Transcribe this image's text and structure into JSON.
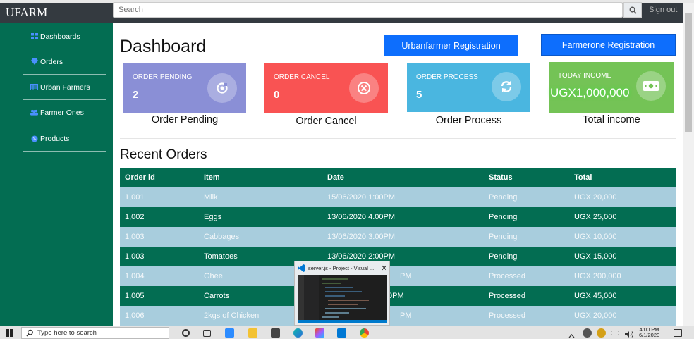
{
  "app": {
    "brand": "UFARM"
  },
  "search": {
    "placeholder": "Search"
  },
  "header": {
    "signout": "Sign out"
  },
  "sidebar": {
    "items": [
      {
        "label": "Dashboards",
        "icon": "grid-icon"
      },
      {
        "label": "Orders",
        "icon": "gem-icon"
      },
      {
        "label": "Urban Farmers",
        "icon": "table-icon"
      },
      {
        "label": "Farmer Ones",
        "icon": "users-icon"
      },
      {
        "label": "Products",
        "icon": "globe-icon"
      }
    ]
  },
  "main": {
    "title": "Dashboard",
    "buttons": {
      "urban": "Urbanfarmer Registration",
      "farmerone": "Farmerone Registration"
    },
    "cards": [
      {
        "label": "ORDER PENDING",
        "value": "2",
        "caption": "Order Pending",
        "color": "#8a8fd6",
        "icon": "pending-icon"
      },
      {
        "label": "ORDER CANCEL",
        "value": "0",
        "caption": "Order Cancel",
        "color": "#f95353",
        "icon": "cancel-icon"
      },
      {
        "label": "ORDER PROCESS",
        "value": "5",
        "caption": "Order Process",
        "color": "#4ab6e0",
        "icon": "refresh-icon"
      },
      {
        "label": "TODAY INCOME",
        "value": "UGX1,000,000",
        "caption": "Total income",
        "color": "#74c356",
        "icon": "money-icon"
      }
    ],
    "recent_title": "Recent Orders",
    "table": {
      "headers": [
        "Order id",
        "Item",
        "Date",
        "Status",
        "Total"
      ],
      "rows": [
        [
          "1,001",
          "Milk",
          "15/06/2020 1:00PM",
          "Pending",
          "UGX 20,000"
        ],
        [
          "1,002",
          "Eggs",
          "13/06/2020 4.00PM",
          "Pending",
          "UGX 25,000"
        ],
        [
          "1,003",
          "Cabbages",
          "13/06/2020 3.00PM",
          "Pending",
          "UGX 10,000"
        ],
        [
          "1,003",
          "Tomatoes",
          "13/06/2020 2:00PM",
          "Pending",
          "UGX 15,000"
        ],
        [
          "1,004",
          "Ghee",
          "PM",
          "Processed",
          "UGX 200,000"
        ],
        [
          "1,005",
          "Carrots",
          "0PM",
          "Processed",
          "UGX 45,000"
        ],
        [
          "1,006",
          "2kgs of Chicken",
          "PM",
          "Processed",
          "UGX 20,000"
        ]
      ]
    }
  },
  "popup": {
    "title": "server.js - Project - Visual ..."
  },
  "taskbar": {
    "search_placeholder": "Type here to search",
    "time": "4:00 PM",
    "date": "6/1/2020"
  }
}
